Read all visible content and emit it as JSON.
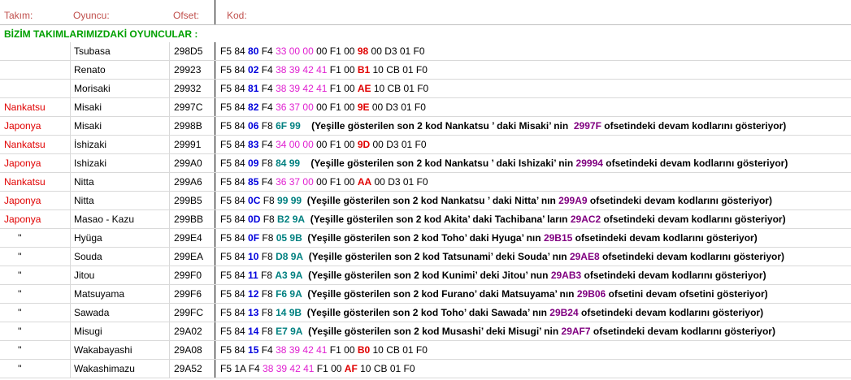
{
  "header": {
    "team": "Takım:",
    "player": "Oyuncu:",
    "offset": "Ofset:",
    "code": "Kod:"
  },
  "section_title": "BİZİM TAKIMLARIMIZDAKİ OYUNCULAR :",
  "colors": {
    "green": "#00a000",
    "red": "#e00000",
    "blue": "#0000dd",
    "magenta": "#e020d0",
    "teal": "#008080",
    "purple": "#800080"
  },
  "rows": [
    {
      "team": "",
      "team_style": "",
      "player": "Tsubasa",
      "offset": "298D5",
      "code": [
        {
          "t": "F5 84 ",
          "c": "plain"
        },
        {
          "t": "80",
          "c": "blue"
        },
        {
          "t": " F4 ",
          "c": "plain"
        },
        {
          "t": "33 00 00",
          "c": "magenta"
        },
        {
          "t": " 00 F1 00 ",
          "c": "plain"
        },
        {
          "t": "98",
          "c": "red"
        },
        {
          "t": " 00 D3 01 F0",
          "c": "plain"
        }
      ]
    },
    {
      "team": "",
      "team_style": "",
      "player": "Renato",
      "offset": "29923",
      "code": [
        {
          "t": "F5 84 ",
          "c": "plain"
        },
        {
          "t": "02",
          "c": "blue"
        },
        {
          "t": " F4 ",
          "c": "plain"
        },
        {
          "t": "38 39 42 41",
          "c": "magenta"
        },
        {
          "t": " F1 00 ",
          "c": "plain"
        },
        {
          "t": "B1",
          "c": "red"
        },
        {
          "t": " 10 CB 01 F0",
          "c": "plain"
        }
      ]
    },
    {
      "team": "",
      "team_style": "",
      "player": "Morisaki",
      "offset": "29932",
      "code": [
        {
          "t": "F5 84 ",
          "c": "plain"
        },
        {
          "t": "81",
          "c": "blue"
        },
        {
          "t": " F4 ",
          "c": "plain"
        },
        {
          "t": "38 39 42 41",
          "c": "magenta"
        },
        {
          "t": " F1 00 ",
          "c": "plain"
        },
        {
          "t": "AE",
          "c": "red"
        },
        {
          "t": " 10 CB 01 F0",
          "c": "plain"
        }
      ]
    },
    {
      "team": "Nankatsu",
      "team_style": "red",
      "player": "Misaki",
      "offset": "2997C",
      "code": [
        {
          "t": "F5 84 ",
          "c": "plain"
        },
        {
          "t": "82",
          "c": "blue"
        },
        {
          "t": " F4 ",
          "c": "plain"
        },
        {
          "t": "36 37 00",
          "c": "magenta"
        },
        {
          "t": " 00 F1 00 ",
          "c": "plain"
        },
        {
          "t": "9E",
          "c": "red"
        },
        {
          "t": " 00 D3 01 F0",
          "c": "plain"
        }
      ]
    },
    {
      "team": "Japonya",
      "team_style": "red",
      "player": "Misaki",
      "offset": "2998B",
      "code": [
        {
          "t": "F5 84 ",
          "c": "plain"
        },
        {
          "t": "06",
          "c": "blue"
        },
        {
          "t": " F8 ",
          "c": "plain"
        },
        {
          "t": "6F 99",
          "c": "teal"
        },
        {
          "t": "    (Yeşille gösterilen son 2 kod Nankatsu ’ daki Misaki’ nin  ",
          "c": "note"
        },
        {
          "t": "2997F",
          "c": "purple"
        },
        {
          "t": " ofsetindeki devam kodlarını gösteriyor)",
          "c": "note"
        }
      ]
    },
    {
      "team": "Nankatsu",
      "team_style": "red",
      "player": "İshizaki",
      "offset": "29991",
      "code": [
        {
          "t": "F5 84 ",
          "c": "plain"
        },
        {
          "t": "83",
          "c": "blue"
        },
        {
          "t": " F4 ",
          "c": "plain"
        },
        {
          "t": "34 00 00",
          "c": "magenta"
        },
        {
          "t": " 00 F1 00 ",
          "c": "plain"
        },
        {
          "t": "9D",
          "c": "red"
        },
        {
          "t": " 00 D3 01 F0",
          "c": "plain"
        }
      ]
    },
    {
      "team": "Japonya",
      "team_style": "red",
      "player": "Ishizaki",
      "offset": "299A0",
      "code": [
        {
          "t": "F5 84 ",
          "c": "plain"
        },
        {
          "t": "09",
          "c": "blue"
        },
        {
          "t": " F8 ",
          "c": "plain"
        },
        {
          "t": "84 99",
          "c": "teal"
        },
        {
          "t": "    (Yeşille gösterilen son 2 kod Nankatsu ’ daki Ishizaki’ nin ",
          "c": "note"
        },
        {
          "t": "29994",
          "c": "purple"
        },
        {
          "t": " ofsetindeki devam kodlarını gösteriyor)",
          "c": "note"
        }
      ]
    },
    {
      "team": "Nankatsu",
      "team_style": "red",
      "player": "Nitta",
      "offset": "299A6",
      "code": [
        {
          "t": "F5 84 ",
          "c": "plain"
        },
        {
          "t": "85",
          "c": "blue"
        },
        {
          "t": " F4 ",
          "c": "plain"
        },
        {
          "t": "36 37 00",
          "c": "magenta"
        },
        {
          "t": " 00 F1 00 ",
          "c": "plain"
        },
        {
          "t": "AA",
          "c": "red"
        },
        {
          "t": " 00 D3 01 F0",
          "c": "plain"
        }
      ]
    },
    {
      "team": "Japonya",
      "team_style": "red",
      "player": "Nitta",
      "offset": "299B5",
      "code": [
        {
          "t": "F5 84 ",
          "c": "plain"
        },
        {
          "t": "0C",
          "c": "blue"
        },
        {
          "t": " F8 ",
          "c": "plain"
        },
        {
          "t": "99 99",
          "c": "teal"
        },
        {
          "t": "  (Yeşille gösterilen son 2 kod Nankatsu ’ daki Nitta’ nın ",
          "c": "note"
        },
        {
          "t": "299A9",
          "c": "purple"
        },
        {
          "t": " ofsetindeki devam kodlarını gösteriyor)",
          "c": "note"
        }
      ]
    },
    {
      "team": "Japonya",
      "team_style": "red",
      "player": "Masao - Kazu",
      "offset": "299BB",
      "code": [
        {
          "t": "F5 84 ",
          "c": "plain"
        },
        {
          "t": "0D",
          "c": "blue"
        },
        {
          "t": " F8 ",
          "c": "plain"
        },
        {
          "t": "B2 9A",
          "c": "teal"
        },
        {
          "t": "  (Yeşille gösterilen son 2 kod Akita’ daki Tachibana’ ların ",
          "c": "note"
        },
        {
          "t": "29AC2",
          "c": "purple"
        },
        {
          "t": " ofsetindeki devam kodlarını gösteriyor)",
          "c": "note"
        }
      ]
    },
    {
      "team": "''",
      "team_style": "quote",
      "player": "Hyüga",
      "offset": "299E4",
      "code": [
        {
          "t": "F5 84 ",
          "c": "plain"
        },
        {
          "t": "0F",
          "c": "blue"
        },
        {
          "t": " F8 ",
          "c": "plain"
        },
        {
          "t": "05 9B",
          "c": "teal"
        },
        {
          "t": "  (Yeşille gösterilen son 2 kod Toho’ daki Hyuga’ nın ",
          "c": "note"
        },
        {
          "t": "29B15",
          "c": "purple"
        },
        {
          "t": " ofsetindeki devam kodlarını gösteriyor)",
          "c": "note"
        }
      ]
    },
    {
      "team": "''",
      "team_style": "quote",
      "player": "Souda",
      "offset": "299EA",
      "code": [
        {
          "t": "F5 84 ",
          "c": "plain"
        },
        {
          "t": "10",
          "c": "blue"
        },
        {
          "t": " F8 ",
          "c": "plain"
        },
        {
          "t": "D8 9A",
          "c": "teal"
        },
        {
          "t": "  (Yeşille gösterilen son 2 kod Tatsunami’ deki Souda’ nın ",
          "c": "note"
        },
        {
          "t": "29AE8",
          "c": "purple"
        },
        {
          "t": " ofsetindeki devam kodlarını gösteriyor)",
          "c": "note"
        }
      ]
    },
    {
      "team": "''",
      "team_style": "quote",
      "player": "Jitou",
      "offset": "299F0",
      "code": [
        {
          "t": "F5 84 ",
          "c": "plain"
        },
        {
          "t": "11",
          "c": "blue"
        },
        {
          "t": " F8 ",
          "c": "plain"
        },
        {
          "t": "A3 9A",
          "c": "teal"
        },
        {
          "t": "  (Yeşille gösterilen son 2 kod Kunimi’ deki Jitou’ nun ",
          "c": "note"
        },
        {
          "t": "29AB3",
          "c": "purple"
        },
        {
          "t": " ofsetindeki devam kodlarını gösteriyor)",
          "c": "note"
        }
      ]
    },
    {
      "team": "''",
      "team_style": "quote",
      "player": "Matsuyama",
      "offset": "299F6",
      "code": [
        {
          "t": "F5 84 ",
          "c": "plain"
        },
        {
          "t": "12",
          "c": "blue"
        },
        {
          "t": " F8 ",
          "c": "plain"
        },
        {
          "t": "F6 9A",
          "c": "teal"
        },
        {
          "t": "  (Yeşille gösterilen son 2 kod Furano’ daki Matsuyama’ nın ",
          "c": "note"
        },
        {
          "t": "29B06",
          "c": "purple"
        },
        {
          "t": " ofsetini devam ofsetini gösteriyor)",
          "c": "note"
        }
      ]
    },
    {
      "team": "''",
      "team_style": "quote",
      "player": "Sawada",
      "offset": "299FC",
      "code": [
        {
          "t": "F5 84 ",
          "c": "plain"
        },
        {
          "t": "13",
          "c": "blue"
        },
        {
          "t": " F8 ",
          "c": "plain"
        },
        {
          "t": "14 9B",
          "c": "teal"
        },
        {
          "t": "  (Yeşille gösterilen son 2 kod Toho’ daki Sawada’ nın ",
          "c": "note"
        },
        {
          "t": "29B24",
          "c": "purple"
        },
        {
          "t": " ofsetindeki devam kodlarını gösteriyor)",
          "c": "note"
        }
      ]
    },
    {
      "team": "''",
      "team_style": "quote",
      "player": "Misugi",
      "offset": "29A02",
      "code": [
        {
          "t": "F5 84 ",
          "c": "plain"
        },
        {
          "t": "14",
          "c": "blue"
        },
        {
          "t": " F8 ",
          "c": "plain"
        },
        {
          "t": "E7 9A",
          "c": "teal"
        },
        {
          "t": "  (Yeşille gösterilen son 2 kod Musashi’ deki Misugi’ nin ",
          "c": "note"
        },
        {
          "t": "29AF7",
          "c": "purple"
        },
        {
          "t": " ofsetindeki devam kodlarını gösteriyor)",
          "c": "note"
        }
      ]
    },
    {
      "team": "''",
      "team_style": "quote",
      "player": "Wakabayashi",
      "offset": "29A08",
      "code": [
        {
          "t": "F5 84 ",
          "c": "plain"
        },
        {
          "t": "15",
          "c": "blue"
        },
        {
          "t": " F4 ",
          "c": "plain"
        },
        {
          "t": "38 39 42 41",
          "c": "magenta"
        },
        {
          "t": " F1 00 ",
          "c": "plain"
        },
        {
          "t": "B0",
          "c": "red"
        },
        {
          "t": " 10 CB 01 F0",
          "c": "plain"
        }
      ]
    },
    {
      "team": "''",
      "team_style": "quote",
      "player": "Wakashimazu",
      "offset": "29A52",
      "code": [
        {
          "t": "F5 1A F4 ",
          "c": "plain"
        },
        {
          "t": "38 39 42 41",
          "c": "magenta"
        },
        {
          "t": " F1 00 ",
          "c": "plain"
        },
        {
          "t": "AF",
          "c": "red"
        },
        {
          "t": " 10 CB 01 F0",
          "c": "plain"
        }
      ]
    }
  ]
}
